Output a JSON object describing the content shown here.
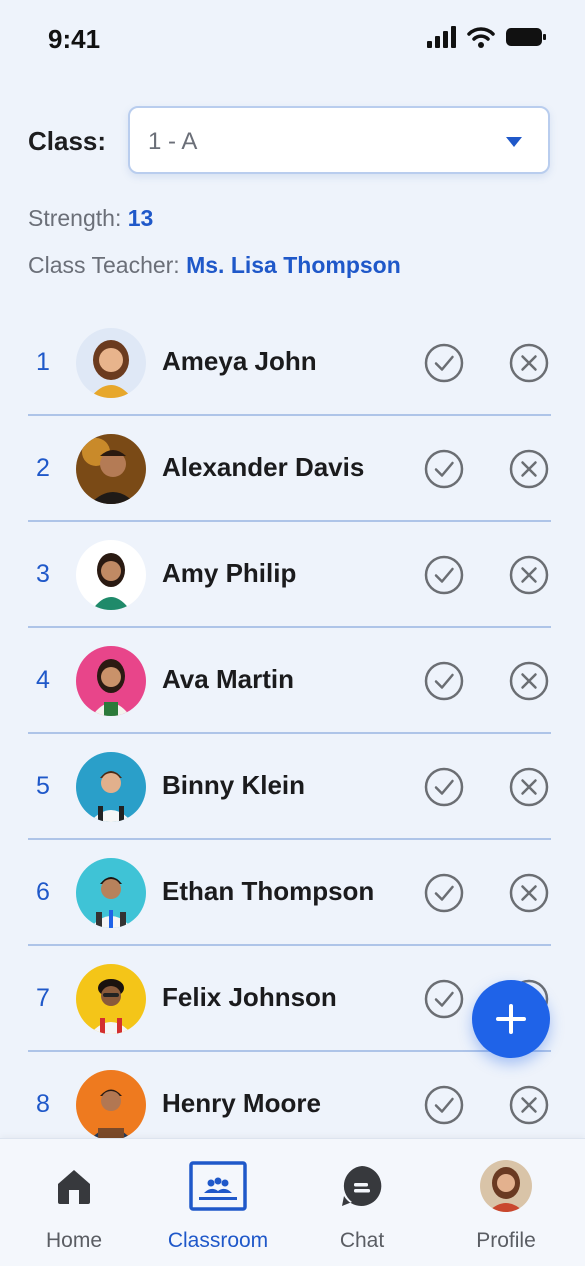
{
  "status_bar": {
    "time": "9:41"
  },
  "class_selector": {
    "label": "Class:",
    "value": "1 - A"
  },
  "strength": {
    "label": "Strength:",
    "value": "13"
  },
  "class_teacher": {
    "label": "Class Teacher:",
    "value": "Ms. Lisa Thompson"
  },
  "students": [
    {
      "roll": "1",
      "name": "Ameya John"
    },
    {
      "roll": "2",
      "name": "Alexander Davis"
    },
    {
      "roll": "3",
      "name": "Amy Philip"
    },
    {
      "roll": "4",
      "name": "Ava Martin"
    },
    {
      "roll": "5",
      "name": "Binny Klein"
    },
    {
      "roll": "6",
      "name": "Ethan Thompson"
    },
    {
      "roll": "7",
      "name": "Felix Johnson"
    },
    {
      "roll": "8",
      "name": "Henry Moore"
    }
  ],
  "tabs": [
    {
      "label": "Home",
      "icon": "home-icon"
    },
    {
      "label": "Classroom",
      "icon": "classroom-icon"
    },
    {
      "label": "Chat",
      "icon": "chat-icon"
    },
    {
      "label": "Profile",
      "icon": "profile-avatar"
    }
  ],
  "colors": {
    "accent": "#1f58c9",
    "fab": "#1f63e8",
    "background": "#eef3fb",
    "divider": "#aec4e8"
  }
}
